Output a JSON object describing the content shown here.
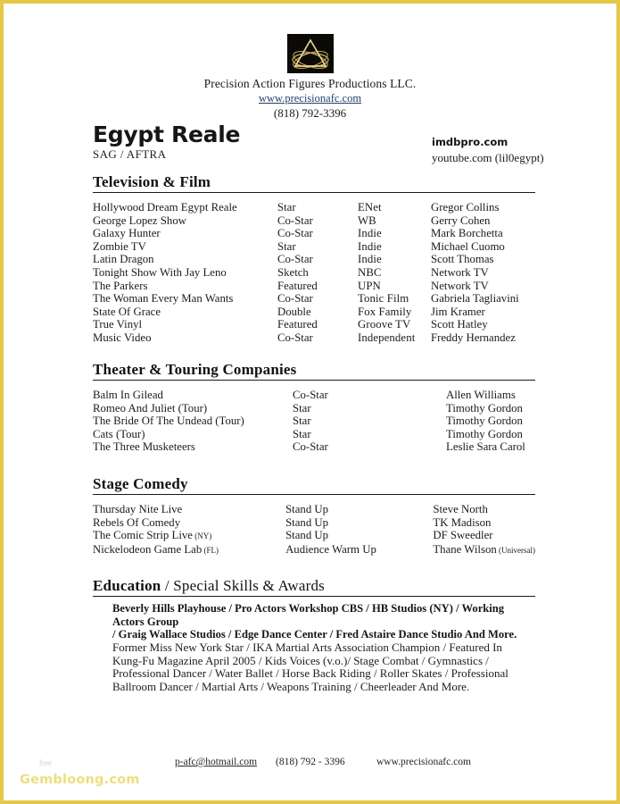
{
  "letterhead": {
    "logo_icon": "triangle-ellipse-logo-icon",
    "company": "Precision Action Figures Productions LLC.",
    "website": "www.precisionafc.com",
    "phone": "(818) 792-3396"
  },
  "header": {
    "name": "Egypt Reale",
    "unions": "SAG / AFTRA",
    "link_imdb": "imdbpro.com",
    "link_youtube": "youtube.com (lil0egypt)"
  },
  "sections": {
    "television": {
      "heading": "Television & Film",
      "rows": [
        {
          "title": "Hollywood Dream Egypt Reale",
          "role": "Star",
          "network": "ENet",
          "director": "Gregor Collins"
        },
        {
          "title": "George Lopez Show",
          "role": "Co-Star",
          "network": "WB",
          "director": "Gerry Cohen"
        },
        {
          "title": "Galaxy Hunter",
          "role": "Co-Star",
          "network": "Indie",
          "director": "Mark Borchetta"
        },
        {
          "title": "Zombie TV",
          "role": "Star",
          "network": "Indie",
          "director": "Michael Cuomo"
        },
        {
          "title": "Latin Dragon",
          "role": "Co-Star",
          "network": "Indie",
          "director": "Scott Thomas"
        },
        {
          "title": "Tonight Show With Jay Leno",
          "role": "Sketch",
          "network": "NBC",
          "director": "Network TV"
        },
        {
          "title": "The Parkers",
          "role": "Featured",
          "network": "UPN",
          "director": "Network TV"
        },
        {
          "title": "The Woman Every Man Wants",
          "role": "Co-Star",
          "network": "Tonic Film",
          "director": "Gabriela Tagliavini"
        },
        {
          "title": "State Of Grace",
          "role": "Double",
          "network": "Fox Family",
          "director": "Jim Kramer"
        },
        {
          "title": "True Vinyl",
          "role": "Featured",
          "network": "Groove TV",
          "director": "Scott Hatley"
        },
        {
          "title": "Music Video",
          "role": "Co-Star",
          "network": "Independent",
          "director": "Freddy Hernandez"
        }
      ]
    },
    "theater": {
      "heading": "Theater & Touring Companies",
      "rows": [
        {
          "title": "Balm In Gilead",
          "role": "Co-Star",
          "director": "Allen Williams"
        },
        {
          "title": "Romeo And Juliet (Tour)",
          "role": "Star",
          "director": "Timothy Gordon"
        },
        {
          "title": "The Bride Of The Undead (Tour)",
          "role": "Star",
          "director": "Timothy Gordon"
        },
        {
          "title": "Cats (Tour)",
          "role": "Star",
          "director": "Timothy Gordon"
        },
        {
          "title": "The Three Musketeers",
          "role": "Co-Star",
          "director": "Leslie Sara Carol"
        }
      ]
    },
    "comedy": {
      "heading": "Stage Comedy",
      "rows": [
        {
          "title": "Thursday Nite Live",
          "title_note": "",
          "role": "Stand Up",
          "director": "Steve North",
          "director_note": ""
        },
        {
          "title": "Rebels Of Comedy",
          "title_note": "",
          "role": "Stand Up",
          "director": "TK Madison",
          "director_note": ""
        },
        {
          "title": "The Comic Strip Live",
          "title_note": "(NY)",
          "role": "Stand Up",
          "director": "DF Sweedler",
          "director_note": ""
        },
        {
          "title": "Nickelodeon Game Lab",
          "title_note": "(FL)",
          "role": "Audience Warm Up",
          "director": "Thane Wilson",
          "director_note": "(Universal)"
        }
      ]
    },
    "education": {
      "heading_bold": "Education",
      "heading_light": " / Special Skills & Awards",
      "bold_lines": [
        "Beverly Hills Playhouse / Pro Actors Workshop CBS / HB Studios (NY) / Working Actors Group",
        "/ Graig Wallace Studios / Edge Dance Center /   Fred Astaire Dance Studio And More."
      ],
      "regular_lines": [
        "Former Miss New York Star / IKA Martial Arts Association Champion / Featured In",
        "Kung-Fu Magazine April 2005 / Kids Voices (v.o.)/ Stage Combat / Gymnastics /",
        "Professional Dancer / Water Ballet / Horse Back Riding / Roller Skates / Professional",
        "Ballroom Dancer / Martial Arts / Weapons Training / Cheerleader And More."
      ]
    }
  },
  "footer": {
    "faint_text": "free",
    "email": "p-afc@hotmail.com",
    "phone": "(818) 792 - 3396",
    "website": "www.precisionafc.com",
    "watermark": "Gembloong.com"
  },
  "colors": {
    "page_border": "#e3c84a",
    "watermark": "#ecdf7e",
    "logo_gold": "#d8c074",
    "link_blue": "#23406b"
  }
}
